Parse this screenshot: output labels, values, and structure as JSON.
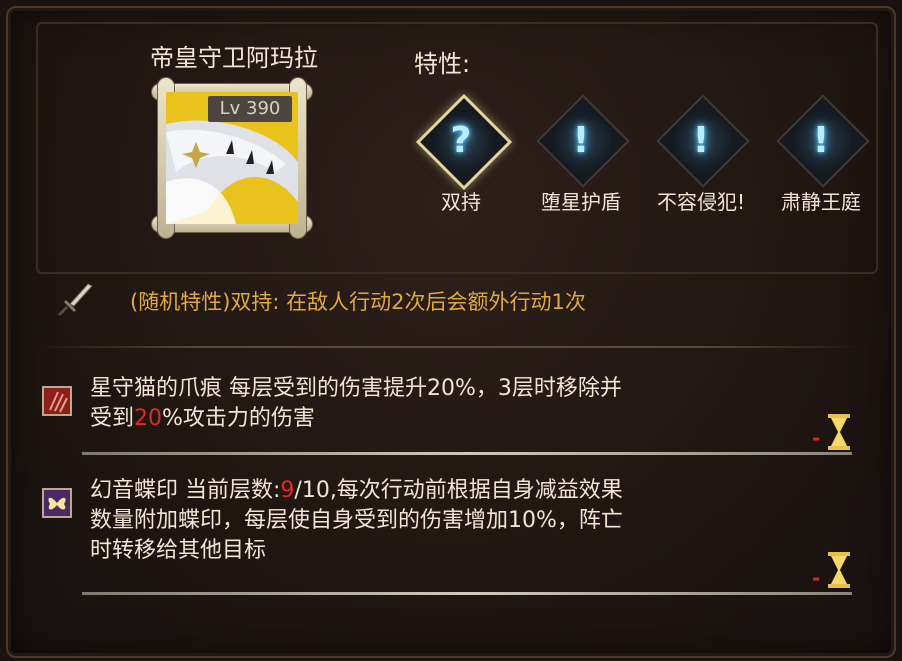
{
  "unit": {
    "name": "帝皇守卫阿玛拉",
    "level": "Lv 390"
  },
  "traits": {
    "label": "特性:",
    "items": [
      {
        "name": "双持",
        "icon": "question-mark-icon",
        "glyph": "?",
        "active": true
      },
      {
        "name": "堕星护盾",
        "icon": "exclamation-icon",
        "glyph": "!",
        "active": false
      },
      {
        "name": "不容侵犯!",
        "icon": "exclamation-icon",
        "glyph": "!",
        "active": false
      },
      {
        "name": "肃静王庭",
        "icon": "exclamation-icon",
        "glyph": "!",
        "active": false
      }
    ],
    "selected_description": "(随机特性)双持: 在敌人行动2次后会额外行动1次"
  },
  "effects": [
    {
      "icon": "claw-mark-icon",
      "line1": "星守猫的爪痕 每层受到的伤害提升20%，3层时移除并",
      "line2_prefix": "受到",
      "line2_highlight": "20",
      "line2_suffix": "%攻击力的伤害",
      "duration": "-"
    },
    {
      "icon": "butterfly-seal-icon",
      "line1_prefix": "幻音蝶印 当前层数:",
      "line1_highlight": "9",
      "line1_suffix": "/10,每次行动前根据自身减益效果",
      "line2": "数量附加蝶印，每层使自身受到的伤害增加10%，阵亡",
      "line3": "时转移给其他目标",
      "duration": "-"
    }
  ],
  "colors": {
    "accent_gold": "#e2a93c",
    "highlight_red": "#e02a1e",
    "text": "#f1e6d4"
  }
}
